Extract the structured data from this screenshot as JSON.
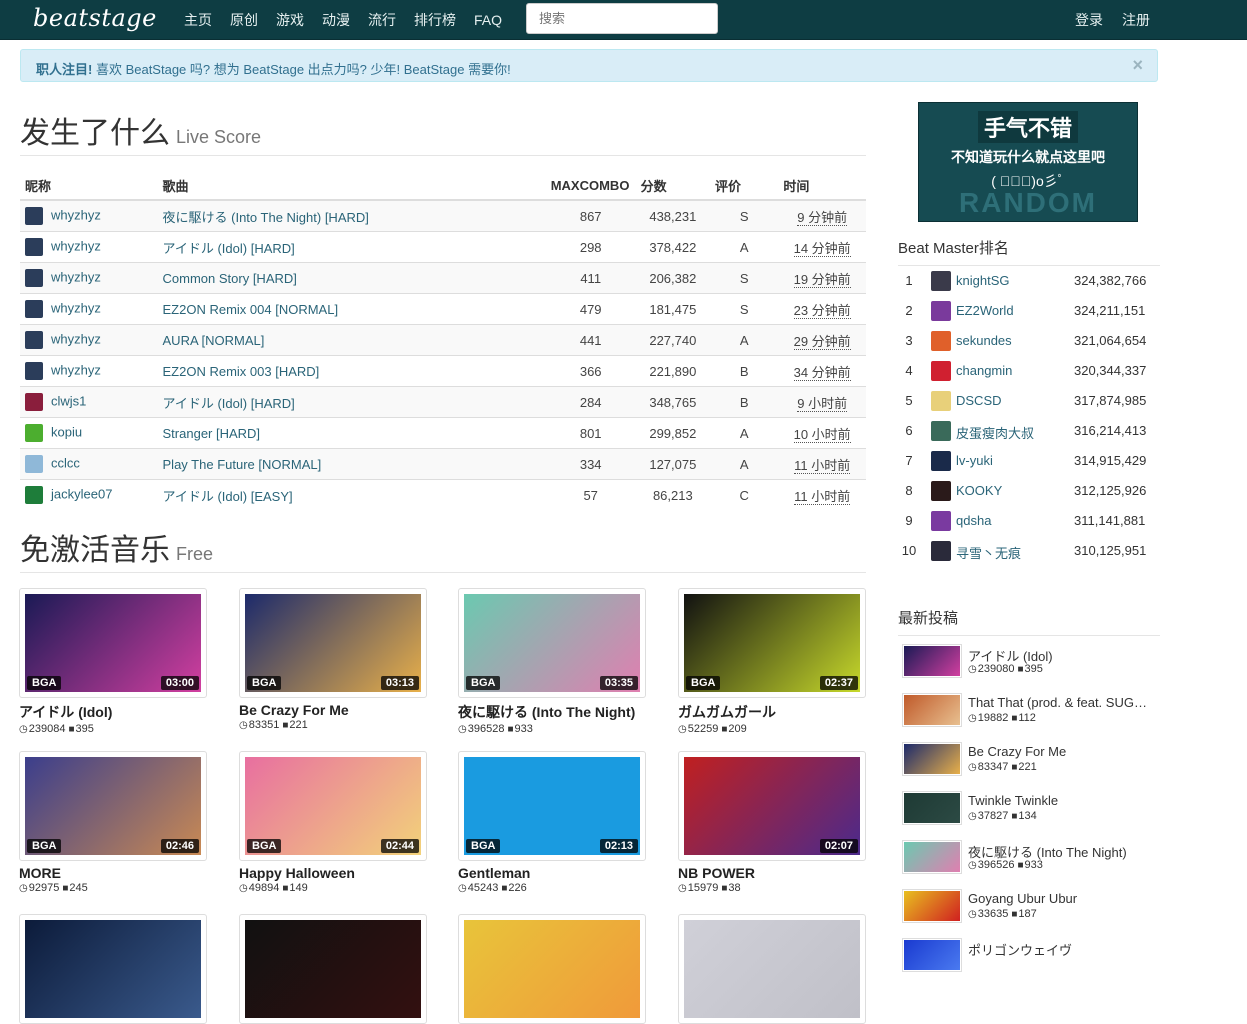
{
  "nav": {
    "logo": "beatstage",
    "links": [
      "主页",
      "原创",
      "游戏",
      "动漫",
      "流行",
      "排行榜",
      "FAQ"
    ],
    "search_placeholder": "搜索",
    "login": "登录",
    "register": "注册"
  },
  "alert": {
    "strong": "职人注目!",
    "text": " 喜欢 BeatStage 吗? 想为 BeatStage 出点力吗? 少年! BeatStage 需要你!",
    "close": "×"
  },
  "live": {
    "title": "发生了什么",
    "subtitle": "Live Score",
    "headers": [
      "昵称",
      "歌曲",
      "MAXCOMBO",
      "分数",
      "评价",
      "时间"
    ],
    "rows": [
      {
        "user": "whyzhyz",
        "song": "夜に駆ける (Into The Night) [HARD]",
        "combo": "867",
        "score": "438,231",
        "grade": "S",
        "time": "9 分钟前",
        "color": "#2b3d5a"
      },
      {
        "user": "whyzhyz",
        "song": "アイドル (Idol) [HARD]",
        "combo": "298",
        "score": "378,422",
        "grade": "A",
        "time": "14 分钟前",
        "color": "#2b3d5a"
      },
      {
        "user": "whyzhyz",
        "song": "Common Story [HARD]",
        "combo": "411",
        "score": "206,382",
        "grade": "S",
        "time": "19 分钟前",
        "color": "#2b3d5a"
      },
      {
        "user": "whyzhyz",
        "song": "EZ2ON Remix 004 [NORMAL]",
        "combo": "479",
        "score": "181,475",
        "grade": "S",
        "time": "23 分钟前",
        "color": "#2b3d5a"
      },
      {
        "user": "whyzhyz",
        "song": "AURA [NORMAL]",
        "combo": "441",
        "score": "227,740",
        "grade": "A",
        "time": "29 分钟前",
        "color": "#2b3d5a"
      },
      {
        "user": "whyzhyz",
        "song": "EZ2ON Remix 003 [HARD]",
        "combo": "366",
        "score": "221,890",
        "grade": "B",
        "time": "34 分钟前",
        "color": "#2b3d5a"
      },
      {
        "user": "clwjs1",
        "song": "アイドル (Idol) [HARD]",
        "combo": "284",
        "score": "348,765",
        "grade": "B",
        "time": "9 小时前",
        "color": "#8a1e3c"
      },
      {
        "user": "kopiu",
        "song": "Stranger [HARD]",
        "combo": "801",
        "score": "299,852",
        "grade": "A",
        "time": "10 小时前",
        "color": "#4cae2f"
      },
      {
        "user": "cclcc",
        "song": "Play The Future [NORMAL]",
        "combo": "334",
        "score": "127,075",
        "grade": "A",
        "time": "11 小时前",
        "color": "#8fb8d8"
      },
      {
        "user": "jackylee07",
        "song": "アイドル (Idol) [EASY]",
        "combo": "57",
        "score": "86,213",
        "grade": "C",
        "time": "11 小时前",
        "color": "#1e7d3a"
      }
    ]
  },
  "free": {
    "title": "免激活音乐",
    "subtitle": "Free",
    "cards": [
      {
        "title": "アイドル (Idol)",
        "bga": "BGA",
        "duration": "03:00",
        "views": "239084",
        "comments": "395",
        "c1": "#1a1a55",
        "c2": "#d23fa0"
      },
      {
        "title": "Be Crazy For Me",
        "bga": "BGA",
        "duration": "03:13",
        "views": "83351",
        "comments": "221",
        "c1": "#1c2a6b",
        "c2": "#e8b04a"
      },
      {
        "title": "夜に駆ける (Into The Night)",
        "bga": "BGA",
        "duration": "03:35",
        "views": "396528",
        "comments": "933",
        "c1": "#6bc9b0",
        "c2": "#e07fb0"
      },
      {
        "title": "ガムガムガール",
        "bga": "BGA",
        "duration": "02:37",
        "views": "52259",
        "comments": "209",
        "c1": "#111111",
        "c2": "#c7d92b"
      },
      {
        "title": "MORE",
        "bga": "BGA",
        "duration": "02:46",
        "views": "92975",
        "comments": "245",
        "c1": "#3b3e8c",
        "c2": "#c98a54"
      },
      {
        "title": "Happy Halloween",
        "bga": "BGA",
        "duration": "02:44",
        "views": "49894",
        "comments": "149",
        "c1": "#e86fa0",
        "c2": "#f2d27a"
      },
      {
        "title": "Gentleman",
        "bga": "BGA",
        "duration": "02:13",
        "views": "45243",
        "comments": "226",
        "c1": "#1a9be0",
        "c2": "#1a9be0"
      },
      {
        "title": "NB POWER",
        "bga": "",
        "duration": "02:07",
        "views": "15979",
        "comments": "38",
        "c1": "#c02020",
        "c2": "#4b2a8c"
      }
    ],
    "partial_colors": [
      [
        "#0c1b3a",
        "#3a5a8c"
      ],
      [
        "#111111",
        "#331010"
      ],
      [
        "#e8c43a",
        "#f09a3a"
      ],
      [
        "#d0d0d8",
        "#c0c0c8"
      ]
    ]
  },
  "banner": {
    "line1": "手气不错",
    "line2": "不知道玩什么就点这里吧",
    "line3": "( ﾟ∀ﾟ)o彡ﾟ",
    "line4": "RANDOM"
  },
  "ranking": {
    "title": "Beat Master排名",
    "items": [
      {
        "rank": "1",
        "name": "knightSG",
        "score": "324,382,766",
        "color": "#3a3a4a"
      },
      {
        "rank": "2",
        "name": "EZ2World",
        "score": "324,211,151",
        "color": "#7a3a9c"
      },
      {
        "rank": "3",
        "name": "sekundes",
        "score": "321,064,654",
        "color": "#e0602a"
      },
      {
        "rank": "4",
        "name": "changmin",
        "score": "320,344,337",
        "color": "#d02030"
      },
      {
        "rank": "5",
        "name": "DSCSD",
        "score": "317,874,985",
        "color": "#e8d07a"
      },
      {
        "rank": "6",
        "name": "皮蛋瘦肉大叔",
        "score": "316,214,413",
        "color": "#3a6a5a"
      },
      {
        "rank": "7",
        "name": "lv-yuki",
        "score": "314,915,429",
        "color": "#1a2a4a"
      },
      {
        "rank": "8",
        "name": "KOOKY",
        "score": "312,125,926",
        "color": "#2a1a1a"
      },
      {
        "rank": "9",
        "name": "qdsha",
        "score": "311,141,881",
        "color": "#7a3aa0"
      },
      {
        "rank": "10",
        "name": "寻雪丶无痕",
        "score": "310,125,951",
        "color": "#2a2a3a"
      }
    ]
  },
  "latest": {
    "title": "最新投稿",
    "items": [
      {
        "title": "アイドル (Idol)",
        "views": "239080",
        "comments": "395",
        "c1": "#1a1a55",
        "c2": "#d23fa0"
      },
      {
        "title": "That That (prod. & feat. SUGA of BTS)",
        "views": "19882",
        "comments": "112",
        "c1": "#c05a2a",
        "c2": "#e8c090"
      },
      {
        "title": "Be Crazy For Me",
        "views": "83347",
        "comments": "221",
        "c1": "#1c2a6b",
        "c2": "#e8b04a"
      },
      {
        "title": "Twinkle Twinkle",
        "views": "37827",
        "comments": "134",
        "c1": "#1e3a34",
        "c2": "#2c4a44"
      },
      {
        "title": "夜に駆ける (Into The Night)",
        "views": "396526",
        "comments": "933",
        "c1": "#6bc9b0",
        "c2": "#e07fb0"
      },
      {
        "title": "Goyang Ubur Ubur",
        "views": "33635",
        "comments": "187",
        "c1": "#e8c020",
        "c2": "#d02020"
      },
      {
        "title": "ポリゴンウェイヴ",
        "views": "",
        "comments": "",
        "c1": "#1a3ad0",
        "c2": "#4a7af0"
      }
    ]
  },
  "icons": {
    "views": "clock-icon",
    "comments": "comment-icon"
  }
}
